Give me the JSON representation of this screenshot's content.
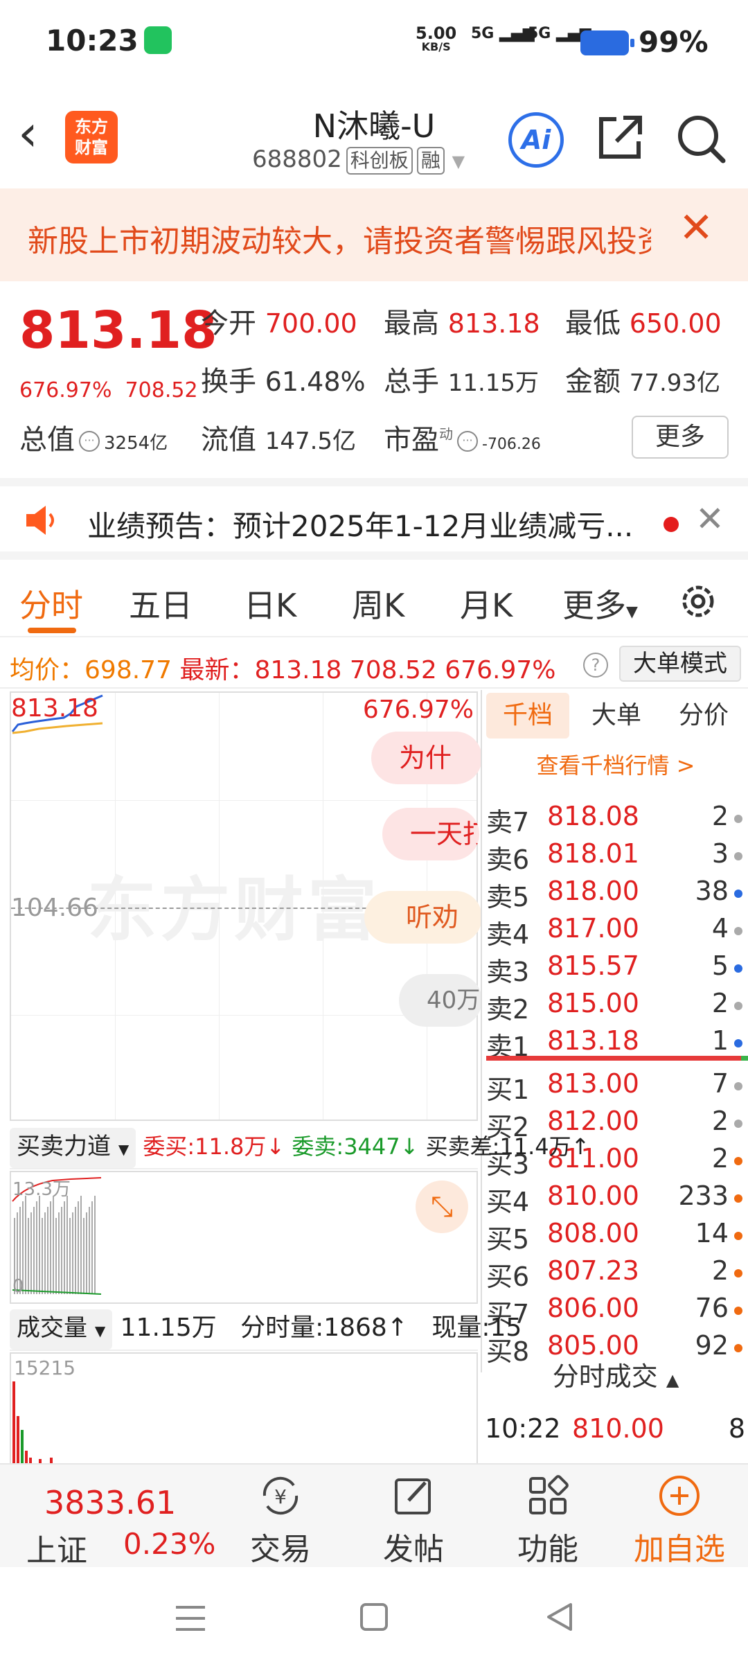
{
  "status_bar": {
    "time": "10:23",
    "net_speed": "5.00",
    "net_unit": "KB/S",
    "sig1": "5G",
    "sig2": "5G",
    "battery": "99%"
  },
  "header": {
    "logo_line1": "东方",
    "logo_line2": "财富",
    "title": "N沐曦-U",
    "code": "688802",
    "tag1": "科创板",
    "tag2": "融",
    "ai_label": "Ai"
  },
  "warning": {
    "text": "新股上市初期波动较大，请投资者警惕跟风投资风险"
  },
  "quote": {
    "price": "813.18",
    "change_pct": "676.97%",
    "change_amt": "708.52",
    "open_label": "今开",
    "open": "700.00",
    "high_label": "最高",
    "high": "813.18",
    "low_label": "最低",
    "low": "650.00",
    "turnover_label": "换手",
    "turnover": "61.48%",
    "volume_label": "总手",
    "volume": "11.15万",
    "amount_label": "金额",
    "amount": "77.93亿",
    "mktcap_label": "总值",
    "mktcap": "3254亿",
    "float_label": "流值",
    "float": "147.5亿",
    "pe_label": "市盈",
    "pe_sup": "动",
    "pe": "-706.26",
    "more": "更多"
  },
  "notice": {
    "text": "业绩预告：预计2025年1-12月业绩减亏..."
  },
  "tabs": [
    "分时",
    "五日",
    "日K",
    "周K",
    "月K",
    "更多"
  ],
  "infoline": {
    "avg_label": "均价：",
    "avg": "698.77",
    "last_label": "最新：",
    "last": "813.18",
    "chg": "708.52",
    "pct": "676.97%",
    "q": "?",
    "big_mode": "大单模式"
  },
  "chart": {
    "top_price": "813.18",
    "mid_price": "104.66",
    "top_pct": "676.97%",
    "watermark": "东方财富",
    "bubble1": "为什",
    "bubble2": "一天打",
    "bubble3": "听劝",
    "bubble4": "40万"
  },
  "book": {
    "tabs": [
      "千档",
      "大单",
      "分价"
    ],
    "view_link": "查看千档行情 >",
    "asks": [
      {
        "label": "卖7",
        "price": "818.08",
        "vol": "2"
      },
      {
        "label": "卖6",
        "price": "818.01",
        "vol": "3"
      },
      {
        "label": "卖5",
        "price": "818.00",
        "vol": "38"
      },
      {
        "label": "卖4",
        "price": "817.00",
        "vol": "4"
      },
      {
        "label": "卖3",
        "price": "815.57",
        "vol": "5"
      },
      {
        "label": "卖2",
        "price": "815.00",
        "vol": "2"
      },
      {
        "label": "卖1",
        "price": "813.18",
        "vol": "1"
      }
    ],
    "bids": [
      {
        "label": "买1",
        "price": "813.00",
        "vol": "7"
      },
      {
        "label": "买2",
        "price": "812.00",
        "vol": "2"
      },
      {
        "label": "买3",
        "price": "811.00",
        "vol": "2"
      },
      {
        "label": "买4",
        "price": "810.00",
        "vol": "233"
      },
      {
        "label": "买5",
        "price": "808.00",
        "vol": "14"
      },
      {
        "label": "买6",
        "price": "807.23",
        "vol": "2"
      },
      {
        "label": "买7",
        "price": "806.00",
        "vol": "76"
      },
      {
        "label": "买8",
        "price": "805.00",
        "vol": "92"
      }
    ],
    "trades_header": "分时成交",
    "trade_time": "10:22",
    "trade_price": "810.00",
    "trade_vol": "8"
  },
  "force": {
    "dropdown": "买卖力道",
    "buy": "委买:11.8万↓",
    "sell": "委卖:3447↓",
    "diff": "买卖差:11.4万↑",
    "top_label": "13.3万",
    "zero_label": "0"
  },
  "volume": {
    "dropdown": "成交量",
    "total": "11.15万",
    "min_vol": "分时量:1868↑",
    "now_vol": "现量:15",
    "max_label": "15215"
  },
  "bottom": {
    "index_value": "3833.61",
    "index_name": "上证",
    "index_pct": "0.23%",
    "trade": "交易",
    "post": "发帖",
    "func": "功能",
    "add": "加自选"
  }
}
